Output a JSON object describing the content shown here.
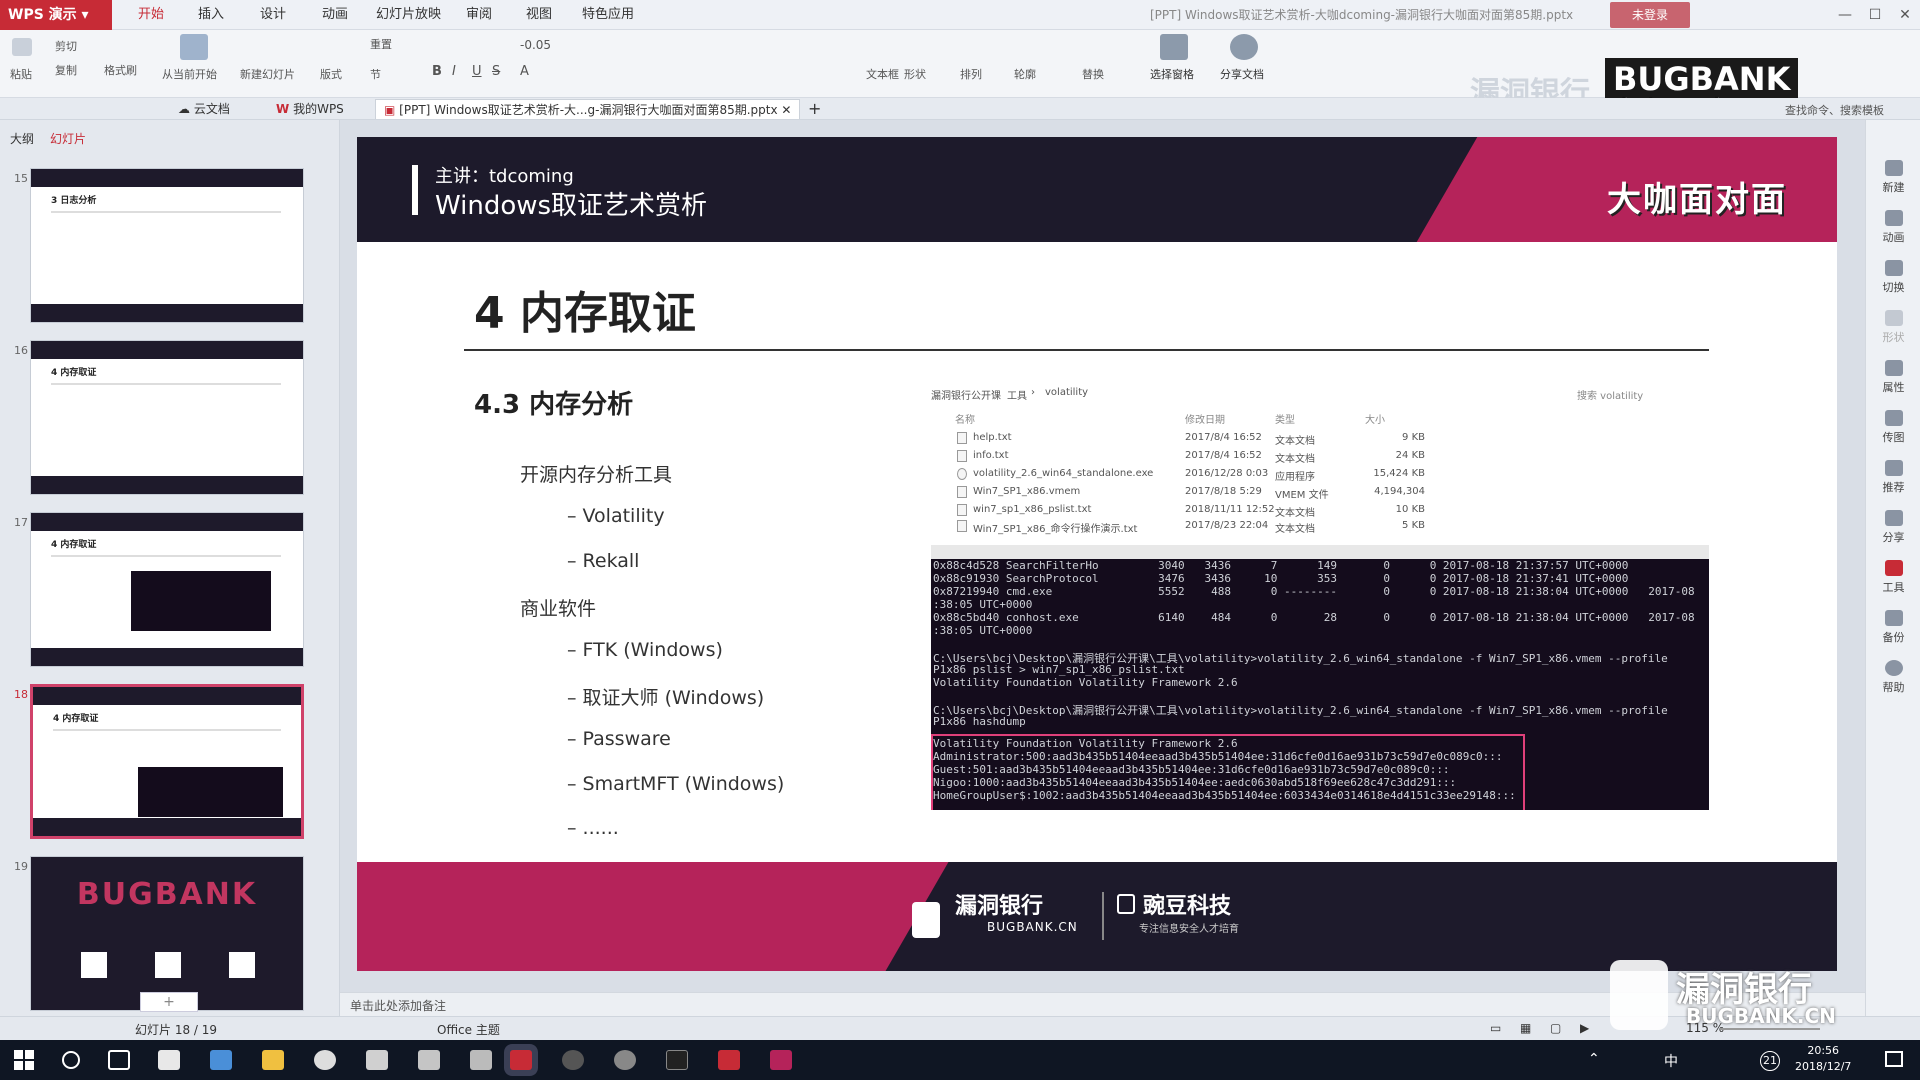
{
  "app": {
    "name": "WPS 演示",
    "menu": [
      "开始",
      "插入",
      "设计",
      "动画",
      "幻灯片放映",
      "审阅",
      "视图",
      "特色应用"
    ],
    "active_menu": "开始",
    "document_title": "[PPT] Windows取证艺术赏析-大咖dcoming-漏洞银行大咖面对面第85期.pptx",
    "login": "未登录",
    "window_controls": [
      "—",
      "☐",
      "✕"
    ]
  },
  "ribbon": {
    "font_size_value": "-0.05",
    "from_current_label": "从当前开始",
    "select_pane_label": "选择窗格",
    "share_doc_label": "分享文档",
    "search_cmd": "查找命令、搜索模板",
    "small_labels": [
      "粘贴",
      "剪切",
      "复制",
      "格式刷",
      "新建幻灯片",
      "版式",
      "重置",
      "节",
      "文本框",
      "形状",
      "排列",
      "轮廓",
      "替换"
    ]
  },
  "tabs": {
    "cloud": "云文档",
    "mywps": "我的WPS",
    "doc": "[PPT] Windows取证艺术赏析-大...g-漏洞银行大咖面对面第85期.pptx",
    "add": "+"
  },
  "leftpanel": {
    "outline_tab": "大纲",
    "slides_tab": "幻灯片",
    "slides": [
      {
        "num": "15",
        "title": "3 日志分析"
      },
      {
        "num": "16",
        "title": "4 内存取证"
      },
      {
        "num": "17",
        "title": "4 内存取证"
      },
      {
        "num": "18",
        "title": "4 内存取证"
      },
      {
        "num": "19",
        "title": "BUGBANK"
      }
    ],
    "add_slide": "+"
  },
  "slide": {
    "speaker": "主讲：tdcoming",
    "title": "Windows取证艺术赏析",
    "brand_head": "大咖面对面",
    "section_title": "4 内存取证",
    "sub_title": "4.3 内存分析",
    "bullets": [
      {
        "text": "开源内存分析工具",
        "level": 1
      },
      {
        "text": "– Volatility",
        "level": 2
      },
      {
        "text": "– Rekall",
        "level": 2
      },
      {
        "text": "商业软件",
        "level": 1
      },
      {
        "text": "– FTK (Windows)",
        "level": 2
      },
      {
        "text": "– 取证大师 (Windows)",
        "level": 2
      },
      {
        "text": "– Passware",
        "level": 2
      },
      {
        "text": "– SmartMFT (Windows)",
        "level": 2
      },
      {
        "text": "– ......",
        "level": 2
      }
    ],
    "explorer": {
      "breadcrumb": [
        "漏洞银行公开课",
        "工具",
        "volatility"
      ],
      "search_placeholder": "搜索 volatility",
      "columns": [
        "名称",
        "修改日期",
        "类型",
        "大小"
      ],
      "files": [
        {
          "name": "help.txt",
          "date": "2017/8/4 16:52",
          "type": "文本文档",
          "size": "9 KB"
        },
        {
          "name": "info.txt",
          "date": "2017/8/4 16:52",
          "type": "文本文档",
          "size": "24 KB"
        },
        {
          "name": "volatility_2.6_win64_standalone.exe",
          "date": "2016/12/28 0:03",
          "type": "应用程序",
          "size": "15,424 KB"
        },
        {
          "name": "Win7_SP1_x86.vmem",
          "date": "2017/8/18 5:29",
          "type": "VMEM 文件",
          "size": "4,194,304"
        },
        {
          "name": "win7_sp1_x86_pslist.txt",
          "date": "2018/11/11 12:52",
          "type": "文本文档",
          "size": "10 KB"
        },
        {
          "name": "Win7_SP1_x86_命令行操作演示.txt",
          "date": "2017/8/23 22:04",
          "type": "文本文档",
          "size": "5 KB"
        }
      ]
    },
    "terminal_lines": [
      "0x88c4d528 SearchFilterHo         3040   3436      7      149       0      0 2017-08-18 21:37:57 UTC+0000",
      "0x88c91930 SearchProtocol         3476   3436     10      353       0      0 2017-08-18 21:37:41 UTC+0000",
      "0x87219940 cmd.exe                5552    488      0 --------       0      0 2017-08-18 21:38:04 UTC+0000   2017-08",
      ":38:05 UTC+0000",
      "0x88c5bd40 conhost.exe            6140    484      0       28       0      0 2017-08-18 21:38:04 UTC+0000   2017-08",
      ":38:05 UTC+0000",
      "",
      "C:\\Users\\bcj\\Desktop\\漏洞银行公开课\\工具\\volatility>volatility_2.6_win64_standalone -f Win7_SP1_x86.vmem --profile",
      "P1x86 pslist > win7_sp1_x86_pslist.txt",
      "Volatility Foundation Volatility Framework 2.6",
      "",
      "C:\\Users\\bcj\\Desktop\\漏洞银行公开课\\工具\\volatility>volatility_2.6_win64_standalone -f Win7_SP1_x86.vmem --profile",
      "P1x86 hashdump",
      "Volatility Foundation Volatility Framework 2.6",
      "Administrator:500:aad3b435b51404eeaad3b435b51404ee:31d6cfe0d16ae931b73c59d7e0c089c0:::",
      "Guest:501:aad3b435b51404eeaad3b435b51404ee:31d6cfe0d16ae931b73c59d7e0c089c0:::",
      "Nigoo:1000:aad3b435b51404eeaad3b435b51404ee:aedc0630abd518f69ee628c47c3dd291:::",
      "HomeGroupUser$:1002:aad3b435b51404eeaad3b435b51404ee:6033434e0314618e4d4151c33ee29148:::"
    ],
    "footer_brand1": "漏洞银行",
    "footer_brand1_sub": "BUGBANK.CN",
    "footer_brand2": "豌豆科技",
    "footer_brand2_sub": "专注信息安全人才培育"
  },
  "rightbar": [
    "新建",
    "动画",
    "切换",
    "形状",
    "属性",
    "传图",
    "推荐",
    "分享",
    "工具",
    "备份",
    "帮助"
  ],
  "notes_placeholder": "单击此处添加备注",
  "status": {
    "slide_counter": "幻灯片 18 / 19",
    "theme": "Office 主题",
    "zoom": "115 %"
  },
  "watermark": {
    "top_text": "漏洞银行",
    "top_brand": "BUGBANK",
    "top_brand2": "大咖面对面",
    "bottom_cn": "漏洞银行",
    "bottom_en": "BUGBANK.CN"
  },
  "taskbar": {
    "time": "20:56",
    "date": "2018/12/7",
    "ime": "中",
    "notif": "21"
  },
  "colors": {
    "brand_red": "#c72b36",
    "slide_dark": "#1d1a2b",
    "slide_accent": "#b5235a",
    "highlight_box": "#e0407a"
  }
}
